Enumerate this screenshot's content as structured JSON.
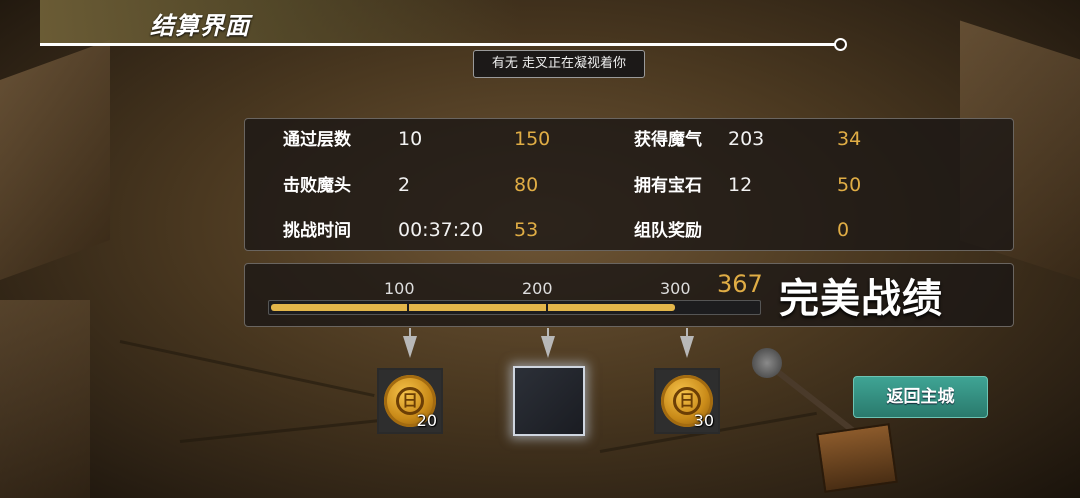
{
  "header": {
    "title": "结算界面",
    "notice": "有无 走叉正在凝视着你"
  },
  "stats": {
    "rows": [
      {
        "label": "通过层数",
        "value": "10",
        "points": "150"
      },
      {
        "label": "击败魔头",
        "value": "2",
        "points": "80"
      },
      {
        "label": "挑战时间",
        "value": "00:37:20",
        "points": "53"
      },
      {
        "label": "获得魔气",
        "value": "203",
        "points": "34"
      },
      {
        "label": "拥有宝石",
        "value": "12",
        "points": "50"
      },
      {
        "label": "组队奖励",
        "value": "",
        "points": "0"
      }
    ]
  },
  "progress": {
    "ticks": [
      "100",
      "200",
      "300"
    ],
    "score": "367",
    "max": 400,
    "rating": "完美战绩"
  },
  "rewards": [
    {
      "icon": "gold-coin-icon",
      "quantity": "20"
    },
    {
      "icon": "empty-slot",
      "quantity": ""
    },
    {
      "icon": "gold-coin-icon",
      "quantity": "30"
    }
  ],
  "actions": {
    "return_label": "返回主城"
  },
  "colors": {
    "gold": "#e0ad45",
    "button": "#3fa494",
    "panel": "#191614"
  }
}
